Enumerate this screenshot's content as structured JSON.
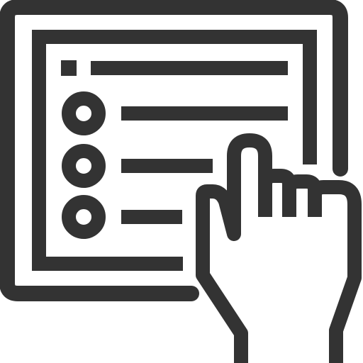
{
  "icon": {
    "name": "tablet-touch-list-icon",
    "stroke_color": "#333333",
    "background_color": "#ffffff",
    "elements": [
      "tablet-frame",
      "screen-panel",
      "list-header-marker",
      "list-header-line",
      "radio-option-1",
      "radio-option-2",
      "radio-option-3",
      "option-line-1",
      "option-line-2",
      "option-line-3",
      "pointing-hand"
    ]
  }
}
